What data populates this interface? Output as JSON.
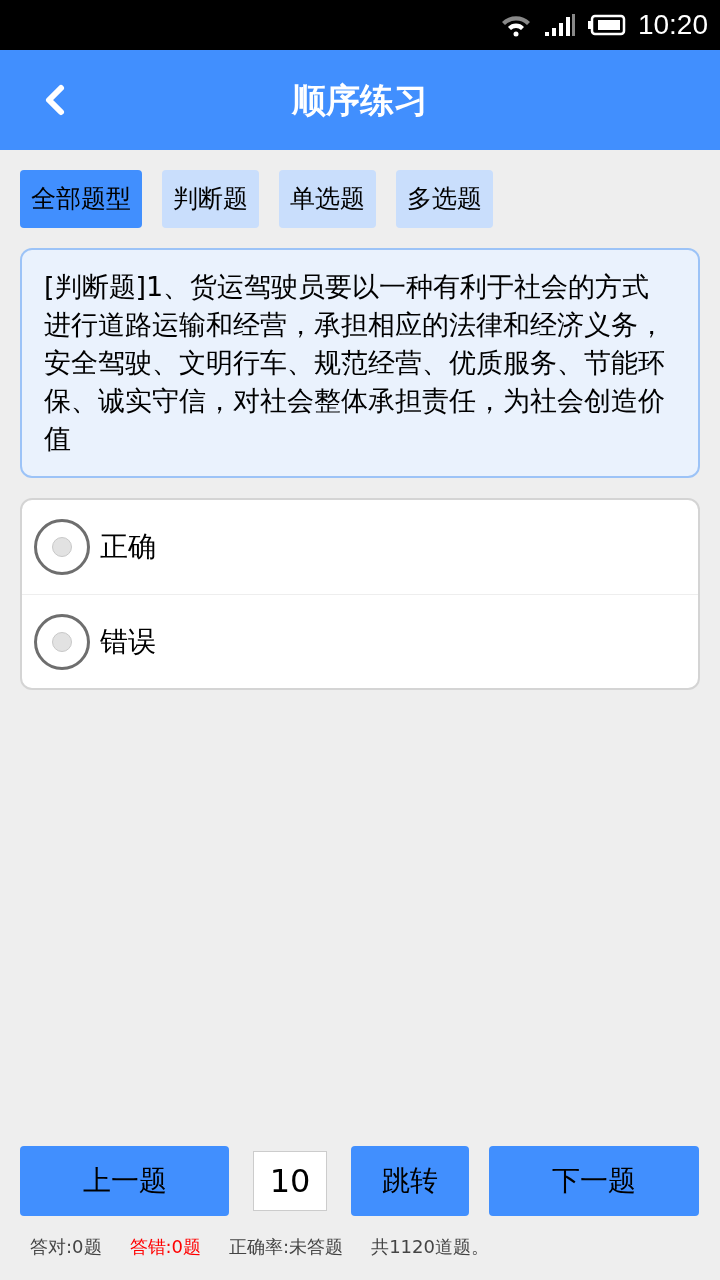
{
  "status_bar": {
    "time": "10:20"
  },
  "header": {
    "title": "顺序练习"
  },
  "tabs": [
    {
      "label": "全部题型",
      "selected": true
    },
    {
      "label": "判断题",
      "selected": false
    },
    {
      "label": "单选题",
      "selected": false
    },
    {
      "label": "多选题",
      "selected": false
    }
  ],
  "question": {
    "text": "[判断题]1、货运驾驶员要以一种有利于社会的方式进行道路运输和经营，承担相应的法律和经济义务，安全驾驶、文明行车、规范经营、优质服务、节能环保、诚实守信，对社会整体承担责任，为社会创造价值"
  },
  "options": [
    {
      "label": "正确",
      "selected": false
    },
    {
      "label": "错误",
      "selected": false
    }
  ],
  "navigation": {
    "prev": "上一题",
    "page": "10",
    "jump": "跳转",
    "next": "下一题"
  },
  "stats": [
    {
      "text": "答对:0题",
      "color": "#444444"
    },
    {
      "text": "答错:0题",
      "color": "#ff0000"
    },
    {
      "text": "正确率:未答题",
      "color": "#444444"
    },
    {
      "text": "共1120道题。",
      "color": "#444444"
    }
  ]
}
